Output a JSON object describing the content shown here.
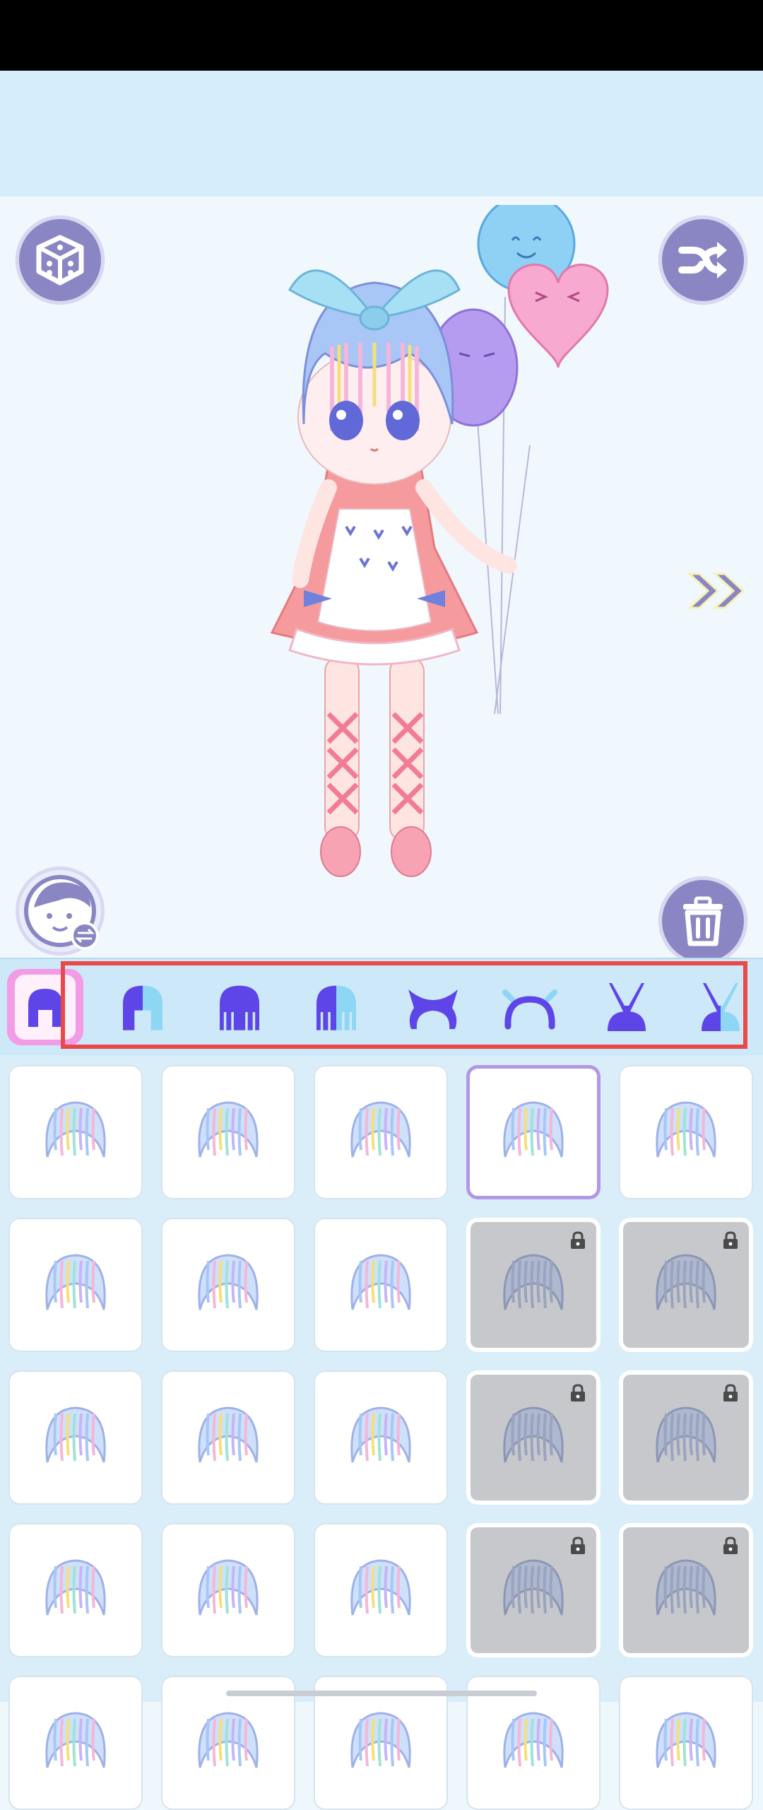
{
  "app": {
    "screen": "hair-selection"
  },
  "colors": {
    "accent": "#8a86c4",
    "tab_icon": "#5e45e8",
    "active_tab": "#f29be6",
    "highlight": "#e84a4a"
  },
  "toolbar": {
    "random_icon": "dice-icon",
    "shuffle_icon": "shuffle-icon",
    "next_icon": "double-chevron-right-icon",
    "face_swap_icon": "face-swap-icon",
    "delete_icon": "trash-icon"
  },
  "category_tabs": [
    {
      "icon": "hair-front-icon",
      "active": true
    },
    {
      "icon": "hair-front-gradient-icon"
    },
    {
      "icon": "hair-back-icon"
    },
    {
      "icon": "hair-back-gradient-icon"
    },
    {
      "icon": "ears-icon"
    },
    {
      "icon": "headband-icon"
    },
    {
      "icon": "bunny-ears-icon"
    },
    {
      "icon": "bunny-ears-gradient-icon"
    }
  ],
  "hair_items": {
    "selected_index": 3,
    "locked_indices": [
      8,
      9,
      13,
      14,
      18,
      19
    ]
  }
}
